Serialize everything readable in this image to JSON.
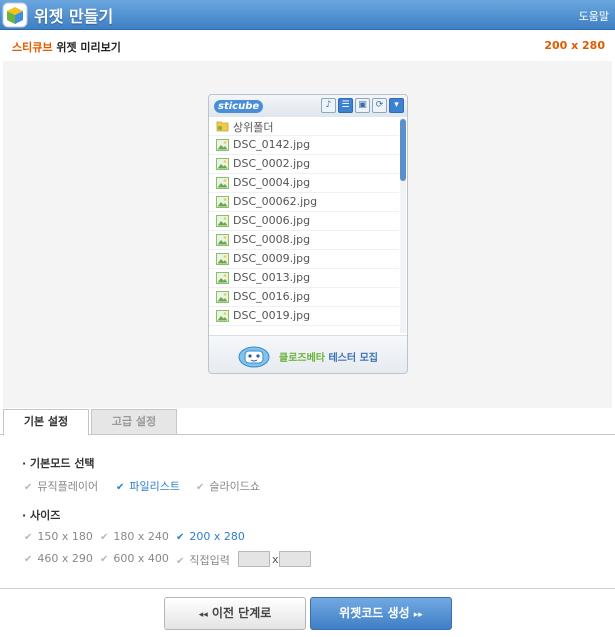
{
  "titlebar": {
    "title": "위젯 만들기",
    "help": "도움말"
  },
  "preview": {
    "brand": "스티큐브",
    "label": "위젯 미리보기",
    "size": "200 x 280"
  },
  "widget": {
    "logo": "sticube",
    "parent_folder": "상위폴더",
    "files": [
      "DSC_0142.jpg",
      "DSC_0002.jpg",
      "DSC_0004.jpg",
      "DSC_00062.jpg",
      "DSC_0006.jpg",
      "DSC_0008.jpg",
      "DSC_0009.jpg",
      "DSC_0013.jpg",
      "DSC_0016.jpg",
      "DSC_0019.jpg"
    ],
    "footer_green": "클로즈베타",
    "footer_blue": " 테스터 모집"
  },
  "tabs": {
    "basic": "기본 설정",
    "advanced": "고급 설정"
  },
  "settings": {
    "mode_label": "· 기본모드 선택",
    "modes": [
      "뮤직플레이어",
      "파일리스트",
      "슬라이드쇼"
    ],
    "size_label": "· 사이즈",
    "sizes_row1": [
      "150 x 180",
      "180 x 240",
      "200 x 280"
    ],
    "sizes_row2": [
      "460 x 290",
      "600 x 400",
      "직접입력"
    ],
    "custom_x": "x"
  },
  "buttons": {
    "prev": "이전 단계로",
    "next": "위젯코드 생성",
    "prev_arrow": "◂◂",
    "next_arrow": "▸▸"
  },
  "colors": {
    "accent": "#2d7fcb",
    "brand": "#e05a00",
    "header": "#3f7fc4"
  }
}
